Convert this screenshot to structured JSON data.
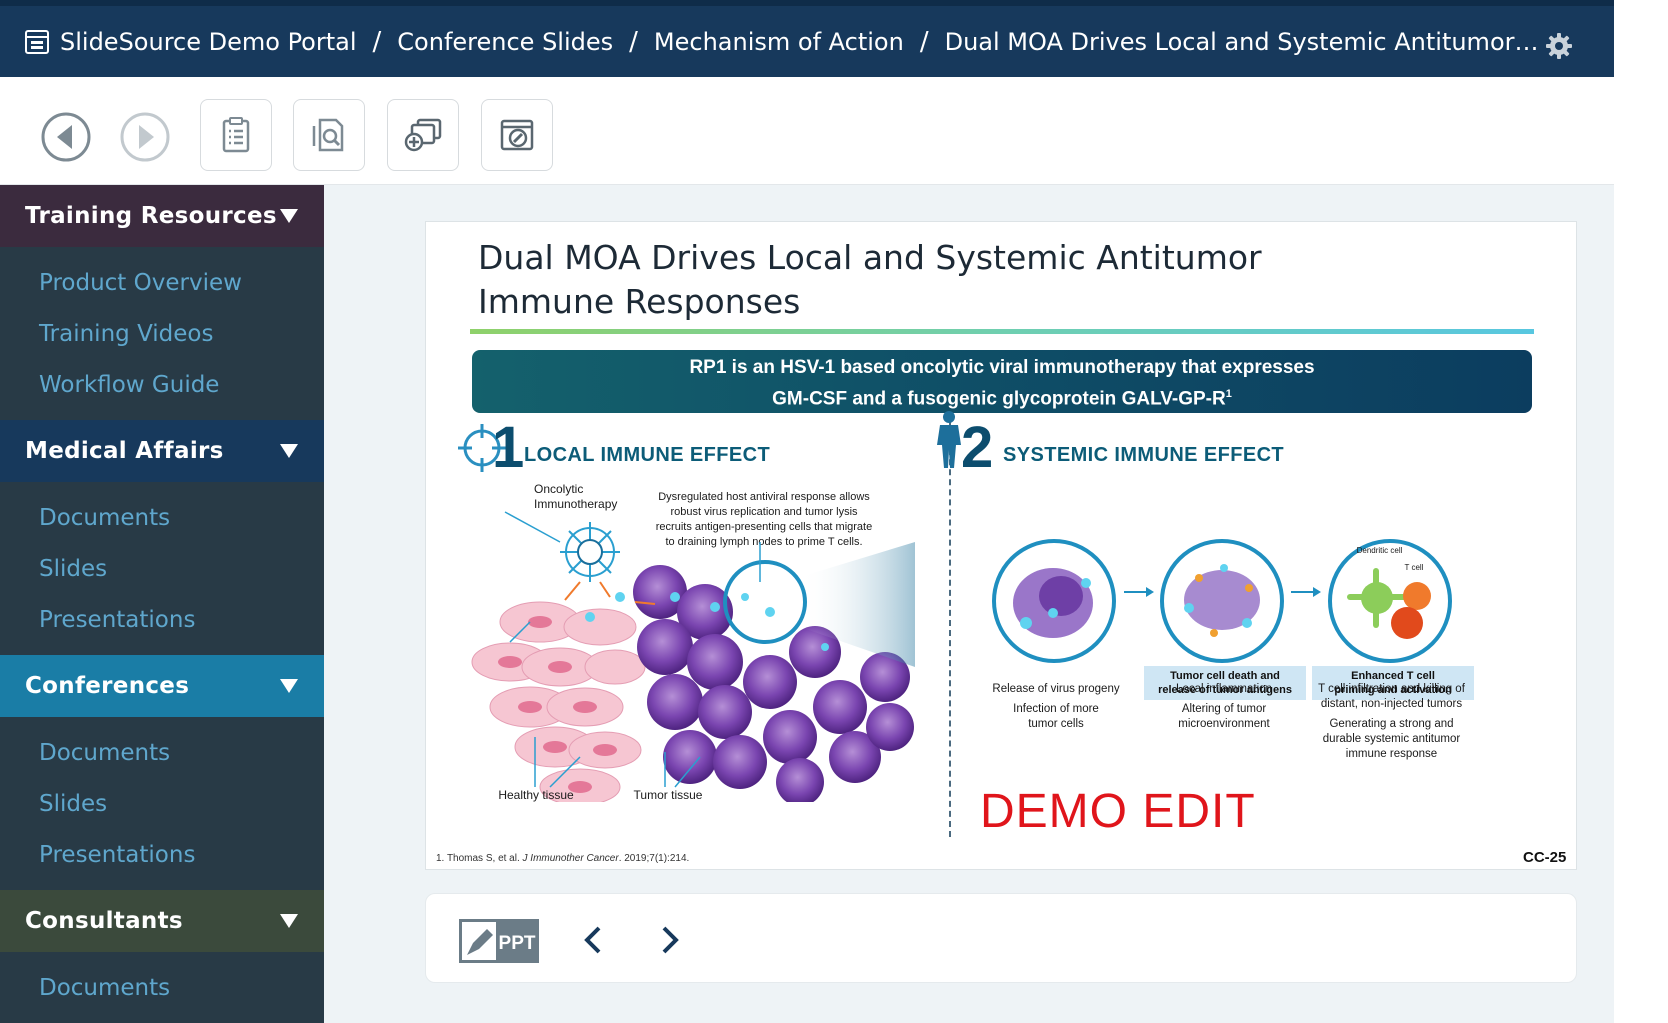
{
  "header": {
    "breadcrumbs": [
      "SlideSource Demo Portal",
      "Conference Slides",
      "Mechanism of Action",
      "Dual MOA Drives Local and Systemic Antitumor Im..."
    ],
    "separator": "/"
  },
  "toolbar": {
    "buttons": [
      "back-icon",
      "forward-icon",
      "notes-icon",
      "search-document-icon",
      "add-to-presentation-icon",
      "edit-slide-icon"
    ]
  },
  "sidebar": {
    "sections": [
      {
        "title": "Training Resources",
        "color": "#3b2b3e",
        "items": [
          "Product Overview",
          "Training Videos",
          "Workflow Guide"
        ]
      },
      {
        "title": "Medical Affairs",
        "color": "#17395c",
        "items": [
          "Documents",
          "Slides",
          "Presentations"
        ]
      },
      {
        "title": "Conferences",
        "color": "#1a7da6",
        "items": [
          "Documents",
          "Slides",
          "Presentations"
        ]
      },
      {
        "title": "Consultants",
        "color": "#3b4a3c",
        "items": [
          "Documents"
        ]
      }
    ]
  },
  "slide": {
    "title_line1": "Dual MOA Drives Local and Systemic Antitumor",
    "title_line2": "Immune Responses",
    "banner_line1": "RP1 is an HSV-1 based oncolytic viral immunotherapy that expresses",
    "banner_line2": "GM-CSF and a fusogenic glycoprotein GALV-GP-R",
    "banner_sup": "1",
    "local": {
      "num": "1",
      "heading": "LOCAL IMMUNE EFFECT",
      "oncolytic_label_1": "Oncolytic",
      "oncolytic_label_2": "Immunotherapy",
      "desc_1": "Dysregulated host antiviral response allows",
      "desc_2": "robust virus replication and tumor lysis",
      "desc_3": "recruits antigen-presenting cells that migrate",
      "desc_4": "to draining lymph nodes to prime T cells.",
      "healthy": "Healthy tissue",
      "tumor": "Tumor tissue"
    },
    "systemic": {
      "num": "2",
      "heading": "SYSTEMIC IMMUNE EFFECT",
      "step2_label_1": "Tumor cell death and",
      "step2_label_2": "release of tumor antigens",
      "step3_label_1": "Enhanced T cell",
      "step3_label_2": "priming and activation",
      "dendritic": "Dendritic cell",
      "tcell": "T cell",
      "c1_a": "Release of virus progeny",
      "c1_b": "Infection of more",
      "c1_c": "tumor cells",
      "c2_a": "Local inflammation",
      "c2_b": "Altering of tumor",
      "c2_c": "microenvironment",
      "c3_a": "T cell infiltration and killing of",
      "c3_b": "distant, non-injected tumors",
      "c3_c": "Generating a strong and",
      "c3_d": "durable systemic antitumor",
      "c3_e": "immune response"
    },
    "demo_edit": "DEMO EDIT",
    "reference_prefix": "1. Thomas S, et al. ",
    "reference_journal": "J Immunother Cancer",
    "reference_suffix": ". 2019;7(1):214.",
    "code": "CC-25"
  },
  "slide_nav": {
    "ppt_label": "PPT"
  }
}
